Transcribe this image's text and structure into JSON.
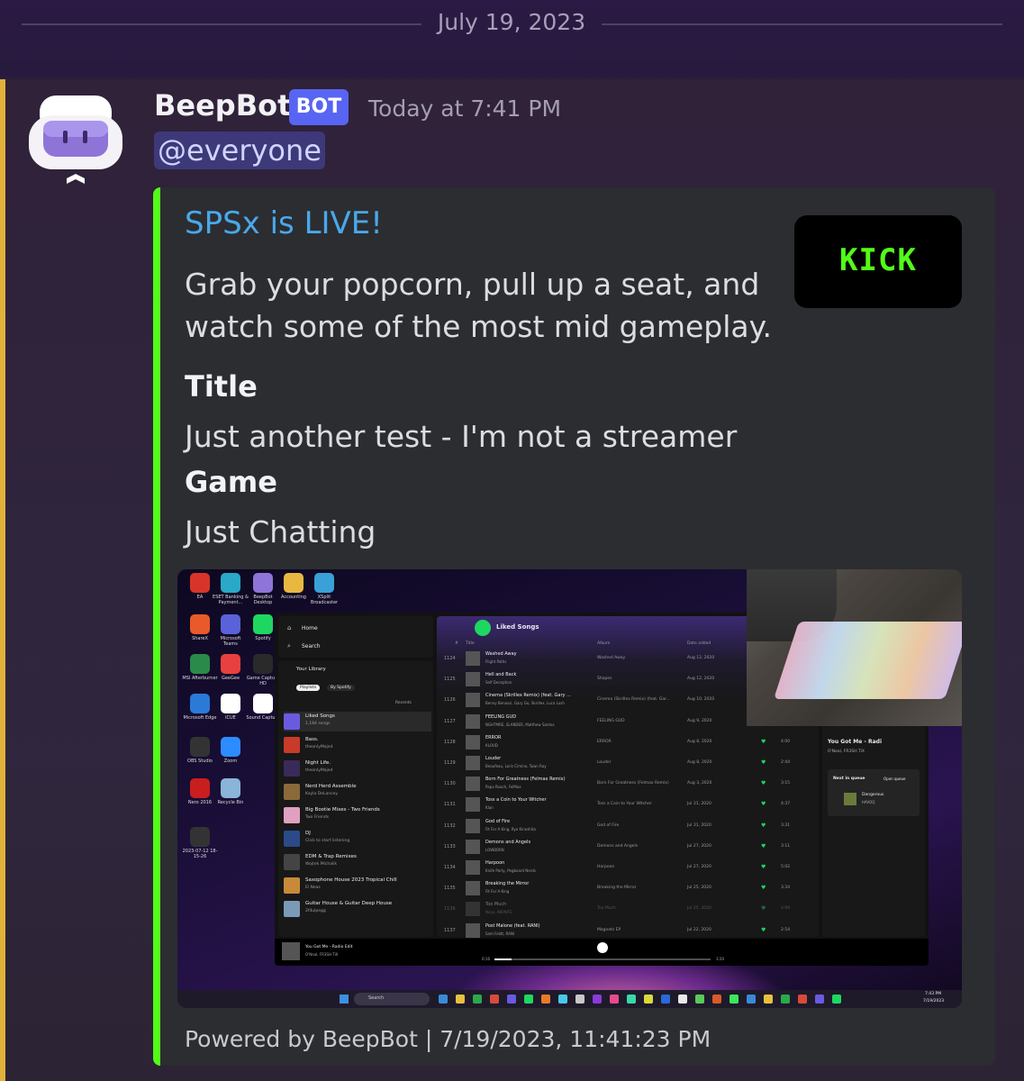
{
  "divider": {
    "date": "July 19, 2023"
  },
  "message": {
    "author": "BeepBot",
    "bot_tag": "BOT",
    "timestamp": "Today at 7:41 PM",
    "mention": "@everyone"
  },
  "embed": {
    "accent_color": "#53fc18",
    "title": "SPSx is LIVE!",
    "description": "Grab your popcorn, pull up a seat, and watch some of the most mid gameplay.",
    "thumbnail_text": "KICK",
    "fields": [
      {
        "name": "Title",
        "value": "Just another test - I'm not a streamer"
      },
      {
        "name": "Game",
        "value": "Just Chatting"
      }
    ],
    "footer": "Powered by BeepBot | 7/19/2023, 11:41:23 PM"
  },
  "screenshot": {
    "desktop_icons": [
      "EA",
      "ESET Banking & Payment...",
      "BeepBot Desktop",
      "Accounting",
      "XSplit Broadcaster",
      "ShareX",
      "Microsoft Teams",
      "Spotify",
      "MSI Afterburner",
      "GeeGee",
      "Game Capture HD",
      "Microsoft Edge",
      "iCUE",
      "Sound Capture",
      "OBS Studio",
      "Zoom",
      "Nero 2016",
      "Recycle Bin",
      "2023-07-12 18-15-26"
    ],
    "spotify": {
      "nav": [
        "Home",
        "Search"
      ],
      "library_label": "Your Library",
      "filters": [
        "Playlists",
        "By Spotify"
      ],
      "sort": "Recents",
      "playlists": [
        {
          "title": "Liked Songs",
          "sub": "1,184 songs"
        },
        {
          "title": "Bass.",
          "sub": "theonlyMajed"
        },
        {
          "title": "Night Life.",
          "sub": "theonlyMajed"
        },
        {
          "title": "Nerd Herd Assemble",
          "sub": "Kayla DeLancey"
        },
        {
          "title": "Big Bootie Mixes - Two Friends",
          "sub": "Two Friends"
        },
        {
          "title": "DJ",
          "sub": "Click to start listening"
        },
        {
          "title": "EDM & Trap Remixes",
          "sub": "Wojtek Michalik"
        },
        {
          "title": "Saxophone House 2023 Tropical Chill",
          "sub": "El Neas"
        },
        {
          "title": "Guitar House & Guitar Deep House",
          "sub": "2f4ulpegg"
        }
      ],
      "header": "Liked Songs",
      "columns": [
        "#",
        "Title",
        "Album",
        "Date added"
      ],
      "tracks": [
        {
          "n": "1124",
          "title": "Washed Away",
          "artist": "Flight Paths",
          "album": "Washed Away",
          "date": "Aug 12, 2020",
          "dur": ""
        },
        {
          "n": "1125",
          "title": "Hell and Back",
          "artist": "Self Deception",
          "album": "Shapes",
          "date": "Aug 12, 2020",
          "dur": ""
        },
        {
          "n": "1126",
          "title": "Cinema (Skrillex Remix) (feat. Gary ...",
          "artist": "Benny Benassi, Gary Go, Skrillex, Luca Lush",
          "album": "Cinema (Skrillex Remix) (feat. Gar...",
          "date": "Aug 10, 2020",
          "dur": ""
        },
        {
          "n": "1127",
          "title": "FEELING GUD",
          "artist": "NGHTMRE, SLANDER, Matthew Santos",
          "album": "FEELING GUD",
          "date": "Aug 9, 2020",
          "dur": ""
        },
        {
          "n": "1128",
          "title": "ERROR",
          "artist": "KLOUD",
          "album": "ERROR",
          "date": "Aug 8, 2020",
          "dur": "4:00"
        },
        {
          "n": "1129",
          "title": "Louder",
          "artist": "Beaufeau, Loris Cimino, Twan Ray",
          "album": "Louder",
          "date": "Aug 8, 2020",
          "dur": "2:44"
        },
        {
          "n": "1130",
          "title": "Born For Greatness (Felmax Remix)",
          "artist": "Papa Roach, FelMax",
          "album": "Born For Greatness (Felmax Remix)",
          "date": "Aug 3, 2020",
          "dur": "3:15"
        },
        {
          "n": "1131",
          "title": "Toss a Coin to Your Witcher",
          "artist": "Klan",
          "album": "Toss a Coin to Your Witcher",
          "date": "Jul 31, 2020",
          "dur": "4:37"
        },
        {
          "n": "1132",
          "title": "God of Fire",
          "artist": "Fit For A King, Ryo Kinoshita",
          "album": "God of Fire",
          "date": "Jul 31, 2020",
          "dur": "3:31"
        },
        {
          "n": "1133",
          "title": "Demons and Angels",
          "artist": "LOWBORN",
          "album": "Demons and Angels",
          "date": "Jul 27, 2020",
          "dur": "3:11"
        },
        {
          "n": "1134",
          "title": "Harpoon",
          "artist": "Knife Party, Pegboard Nerds",
          "album": "Harpoon",
          "date": "Jul 27, 2020",
          "dur": "5:02"
        },
        {
          "n": "1135",
          "title": "Breaking the Mirror",
          "artist": "Fit For A King",
          "album": "Breaking the Mirror",
          "date": "Jul 25, 2020",
          "dur": "3:34"
        },
        {
          "n": "1136",
          "title": "Too Much",
          "artist": "Neyo, INFINITE",
          "album": "Too Much",
          "date": "Jul 25, 2020",
          "dur": "4:09"
        },
        {
          "n": "1137",
          "title": "Post Malone (feat. RANI)",
          "artist": "Sam Feldt, RANI",
          "album": "Magnets EP",
          "date": "Jul 22, 2020",
          "dur": "2:54"
        }
      ],
      "now_playing": {
        "title": "You Got Me - Radio Edit",
        "artist": "O'Neal, FR3SH TiX",
        "elapsed": "0:16",
        "total": "3:20"
      },
      "right_panel": {
        "title": "You Got Me - Radi",
        "artist": "O'Neal, FR3SH TiX",
        "queue_label": "Next in queue",
        "open_queue": "Open queue",
        "next_title": "Dangerous",
        "next_artist": "HAVOQ"
      }
    },
    "taskbar": {
      "search": "Search",
      "time": "7:43 PM",
      "date": "7/19/2023"
    }
  }
}
